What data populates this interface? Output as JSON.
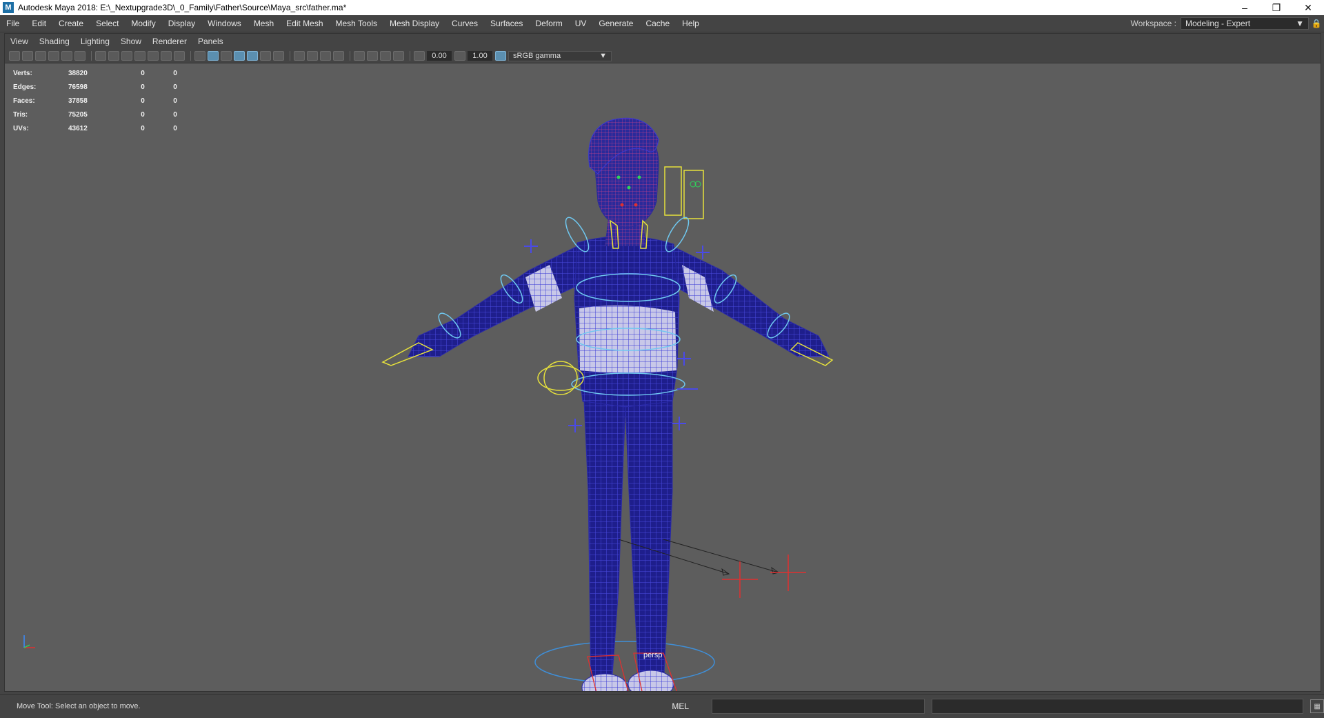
{
  "window": {
    "title": "Autodesk Maya 2018: E:\\_Nextupgrade3D\\_0_Family\\Father\\Source\\Maya_src\\father.ma*",
    "app_icon": "M"
  },
  "menu": [
    "File",
    "Edit",
    "Create",
    "Select",
    "Modify",
    "Display",
    "Windows",
    "Mesh",
    "Edit Mesh",
    "Mesh Tools",
    "Mesh Display",
    "Curves",
    "Surfaces",
    "Deform",
    "UV",
    "Generate",
    "Cache",
    "Help"
  ],
  "workspace": {
    "label": "Workspace :",
    "value": "Modeling - Expert"
  },
  "panel_menu": [
    "View",
    "Shading",
    "Lighting",
    "Show",
    "Renderer",
    "Panels"
  ],
  "toolbar": {
    "field1": "0.00",
    "field2": "1.00",
    "color_space": "sRGB gamma"
  },
  "hud": [
    {
      "label": "Verts:",
      "values": [
        "38820",
        "0",
        "0"
      ]
    },
    {
      "label": "Edges:",
      "values": [
        "76598",
        "0",
        "0"
      ]
    },
    {
      "label": "Faces:",
      "values": [
        "37858",
        "0",
        "0"
      ]
    },
    {
      "label": "Tris:",
      "values": [
        "75205",
        "0",
        "0"
      ]
    },
    {
      "label": "UVs:",
      "values": [
        "43612",
        "0",
        "0"
      ]
    }
  ],
  "camera_label": "persp",
  "status": {
    "help_line": "Move Tool: Select an object to move.",
    "mel_label": "MEL"
  },
  "colors": {
    "mesh": "#1e1e8c",
    "wire": "#3a3ad6",
    "control": "#e6e13c",
    "control_blue": "#6fc8f0",
    "locator_red": "#e03030",
    "viewport_bg": "#5d5d5d"
  }
}
